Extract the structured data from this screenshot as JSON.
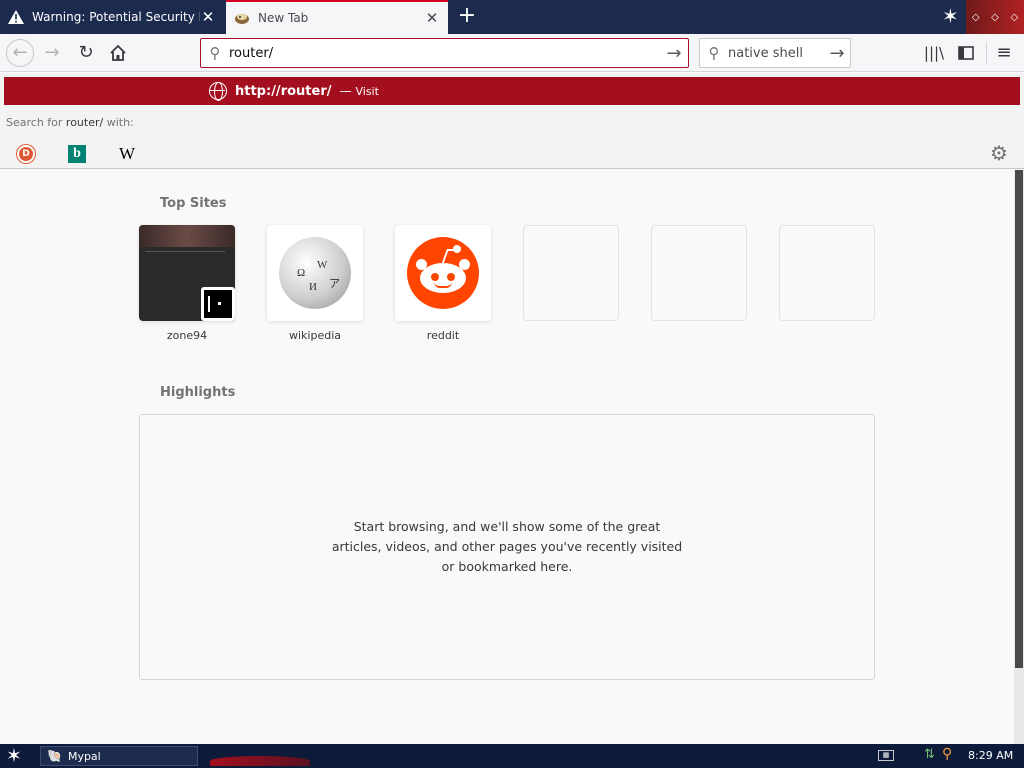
{
  "tabs": [
    {
      "title": "Warning: Potential Security Risk Ahead",
      "icon": "warning-icon"
    },
    {
      "title": "New Tab",
      "icon": "app-favicon-icon"
    }
  ],
  "navbar": {
    "url_value": "router/",
    "search_value": "native shell"
  },
  "urlbar_dropdown": {
    "suggestion": {
      "scheme": "http://",
      "host": "router/",
      "separator": "—",
      "action": "Visit"
    },
    "search_for_prefix": "Search for ",
    "search_for_query": "router/",
    "search_for_suffix": " with:",
    "engines": [
      {
        "name": "DuckDuckGo",
        "icon": "duckduckgo-icon",
        "glyph": "D"
      },
      {
        "name": "Bing",
        "icon": "bing-icon",
        "glyph": "b"
      },
      {
        "name": "Wikipedia",
        "icon": "wikipedia-icon",
        "glyph": "W"
      }
    ]
  },
  "top_sites": {
    "title": "Top Sites",
    "sites": [
      {
        "label": "zone94"
      },
      {
        "label": "wikipedia"
      },
      {
        "label": "reddit"
      },
      {
        "label": ""
      },
      {
        "label": ""
      },
      {
        "label": ""
      }
    ]
  },
  "highlights": {
    "title": "Highlights",
    "empty_message": "Start browsing, and we'll show some of the great articles, videos, and other pages you've recently visited or bookmarked here."
  },
  "taskbar": {
    "task_label": "Mypal",
    "clock": "8:29 AM"
  },
  "colors": {
    "accent": "#a40f1f",
    "tabstrip": "#1c2a4e",
    "taskbar": "#0e1a3a"
  }
}
